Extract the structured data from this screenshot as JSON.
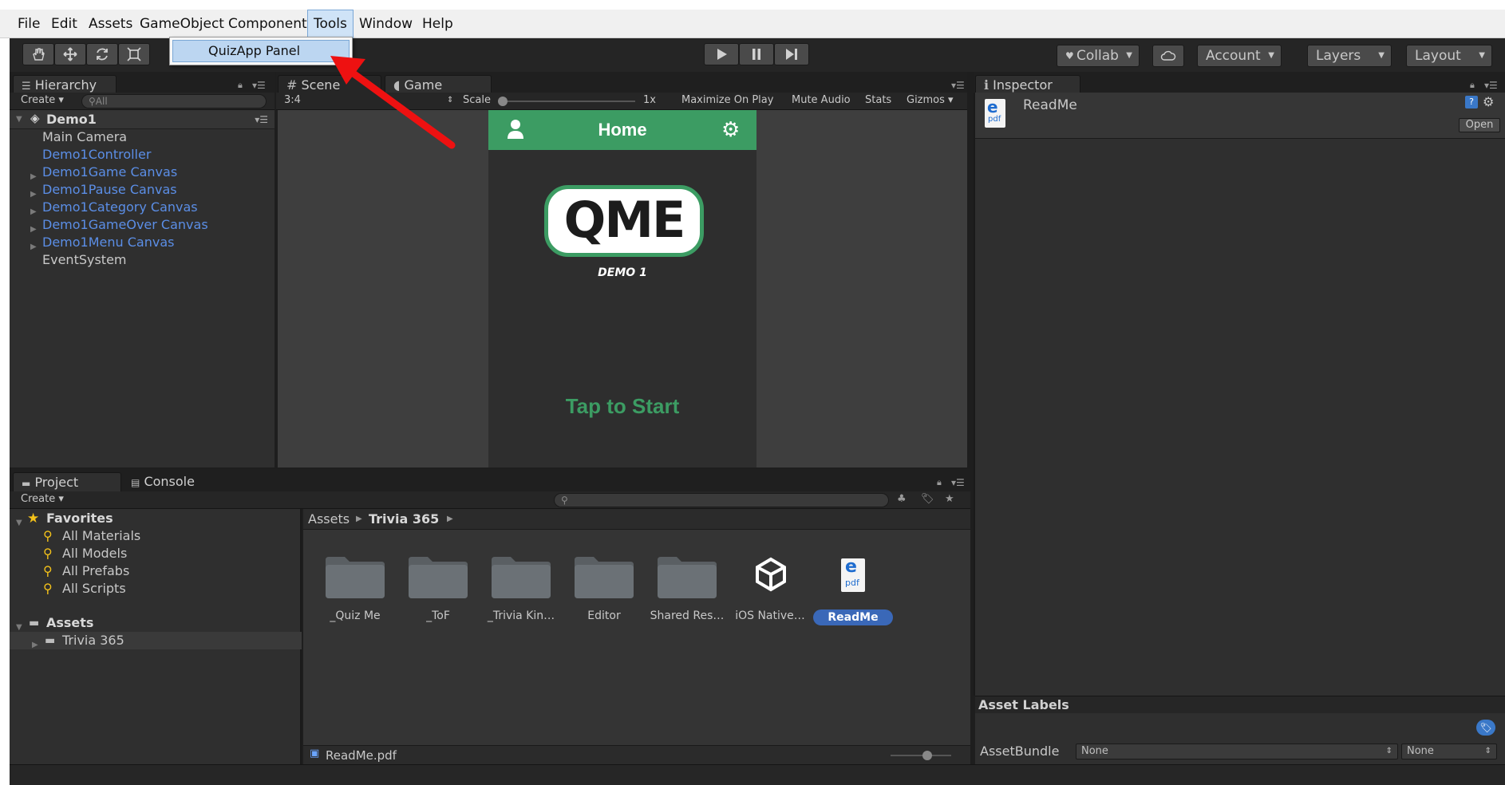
{
  "menubar": {
    "items": [
      "File",
      "Edit",
      "Assets",
      "GameObject",
      "Component",
      "Tools",
      "Window",
      "Help"
    ],
    "active": "Tools"
  },
  "tools_menu": {
    "items": [
      "QuizApp Panel"
    ]
  },
  "toolbar": {
    "transform_tools": [
      "hand-icon",
      "move-icon",
      "rotate-icon",
      "scale-icon"
    ],
    "play_controls": [
      "play-icon",
      "pause-icon",
      "step-icon"
    ],
    "collab_label": "Collab",
    "account_label": "Account",
    "layers_label": "Layers",
    "layout_label": "Layout"
  },
  "hierarchy": {
    "tab_label": "Hierarchy",
    "create_label": "Create",
    "search_placeholder": "All",
    "scene_name": "Demo1",
    "items": [
      {
        "label": "Main Camera"
      },
      {
        "label": "Demo1Controller"
      },
      {
        "label": "Demo1Game Canvas"
      },
      {
        "label": "Demo1Pause Canvas"
      },
      {
        "label": "Demo1Category Canvas"
      },
      {
        "label": "Demo1GameOver Canvas"
      },
      {
        "label": "Demo1Menu Canvas"
      },
      {
        "label": "EventSystem"
      }
    ]
  },
  "views": {
    "scene_tab": "Scene",
    "game_tab": "Game",
    "aspect": "3:4",
    "scale_label": "Scale",
    "scale_value": "1x",
    "maximize_label": "Maximize On Play",
    "mute_label": "Mute Audio",
    "stats_label": "Stats",
    "gizmos_label": "Gizmos"
  },
  "game": {
    "header_title": "Home",
    "logo_text": "QME",
    "logo_subtitle": "DEMO 1",
    "tap_text": "Tap to Start",
    "colors": {
      "header": "#3c9c63",
      "tap_text": "#3c9c63"
    }
  },
  "project": {
    "tab_label": "Project",
    "console_label": "Console",
    "create_label": "Create",
    "favorites_label": "Favorites",
    "favorites": [
      {
        "label": "All Materials"
      },
      {
        "label": "All Models"
      },
      {
        "label": "All Prefabs"
      },
      {
        "label": "All Scripts"
      }
    ],
    "assets_label": "Assets",
    "assets_children": [
      {
        "label": "Trivia 365"
      }
    ],
    "breadcrumb": {
      "root": "Assets",
      "current": "Trivia 365"
    },
    "grid": [
      {
        "label": "_Quiz Me",
        "kind": "folder"
      },
      {
        "label": "_ToF",
        "kind": "folder"
      },
      {
        "label": "_Trivia Kin…",
        "kind": "folder"
      },
      {
        "label": "Editor",
        "kind": "folder"
      },
      {
        "label": "Shared Res…",
        "kind": "folder"
      },
      {
        "label": "iOS Native…",
        "kind": "unity"
      },
      {
        "label": "ReadMe",
        "kind": "pdf",
        "selected": true
      }
    ],
    "footer_file": "ReadMe.pdf"
  },
  "inspector": {
    "tab_label": "Inspector",
    "object_name": "ReadMe",
    "open_label": "Open",
    "asset_labels_title": "Asset Labels",
    "assetbundle_label": "AssetBundle",
    "bundle_value": "None",
    "variant_value": "None"
  }
}
